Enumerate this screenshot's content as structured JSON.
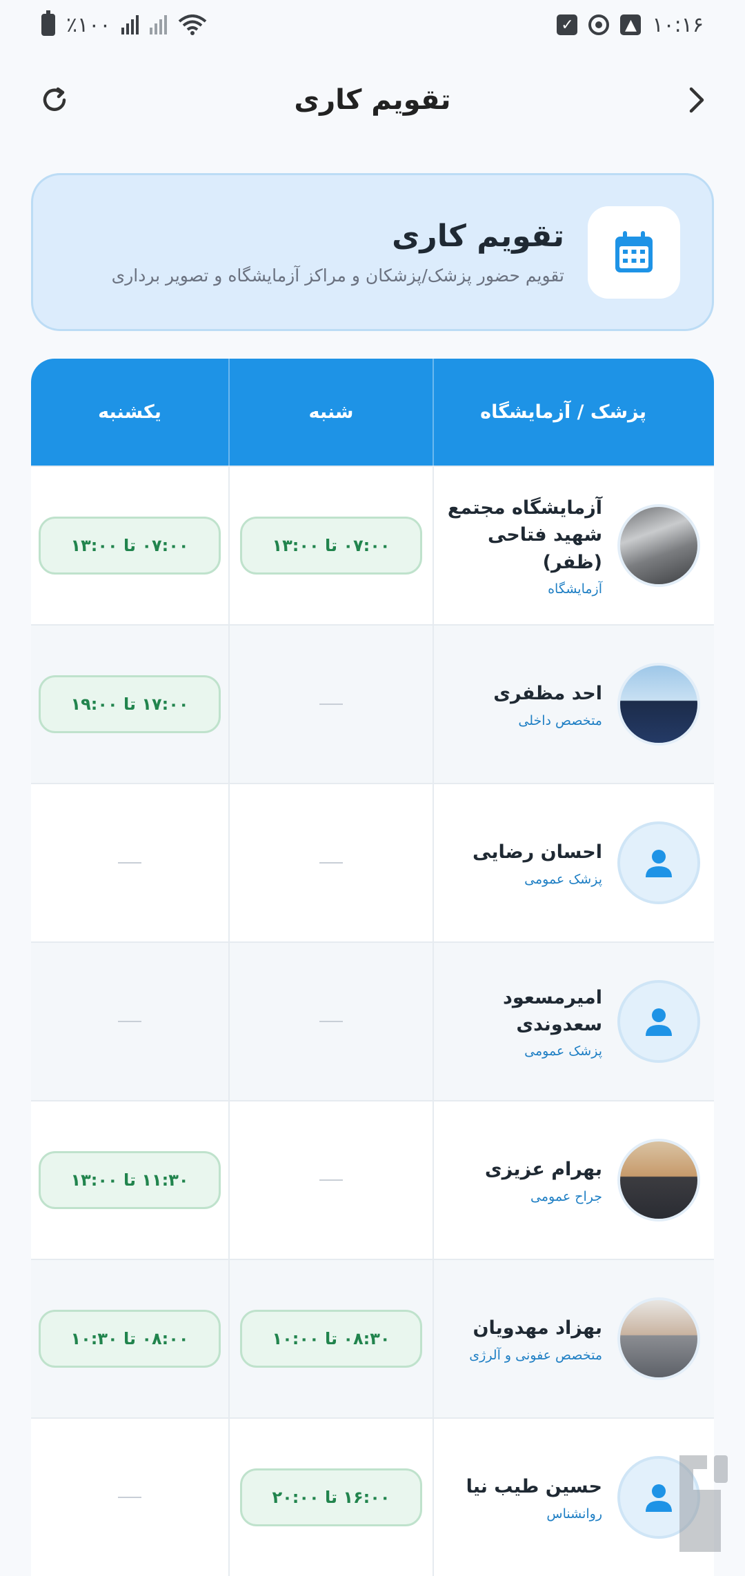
{
  "status_bar": {
    "time": "۱۰:۱۶",
    "battery": "٪۱۰۰"
  },
  "header": {
    "title": "تقویم کاری"
  },
  "banner": {
    "title": "تقویم کاری",
    "subtitle": "تقویم حضور پزشک/پزشکان و مراکز آزمایشگاه و تصویر برداری"
  },
  "table": {
    "headers": {
      "name": "پزشک / آزمایشگاه",
      "saturday": "شنبه",
      "sunday": "یکشنبه"
    },
    "rows": [
      {
        "name": "آزمایشگاه مجتمع شهید فتاحی (ظفر)",
        "role": "آزمایشگاه",
        "saturday": "۰۷:۰۰ تا ۱۳:۰۰",
        "sunday": "۰۷:۰۰ تا ۱۳:۰۰"
      },
      {
        "name": "احد مظفری",
        "role": "متخصص داخلی",
        "saturday": "",
        "sunday": "۱۷:۰۰ تا ۱۹:۰۰"
      },
      {
        "name": "احسان رضایی",
        "role": "پزشک عمومی",
        "saturday": "",
        "sunday": ""
      },
      {
        "name": "امیرمسعود سعدوندی",
        "role": "پزشک عمومی",
        "saturday": "",
        "sunday": ""
      },
      {
        "name": "بهرام عزیزی",
        "role": "جراح عمومی",
        "saturday": "",
        "sunday": "۱۱:۳۰ تا ۱۳:۰۰"
      },
      {
        "name": "بهزاد مهدویان",
        "role": "متخصص عفونی و آلرژی",
        "saturday": "۰۸:۳۰ تا ۱۰:۰۰",
        "sunday": "۰۸:۰۰ تا ۱۰:۳۰"
      },
      {
        "name": "حسین طیب نیا",
        "role": "روانشناس",
        "saturday": "۱۶:۰۰ تا ۲۰:۰۰",
        "sunday": ""
      }
    ]
  }
}
